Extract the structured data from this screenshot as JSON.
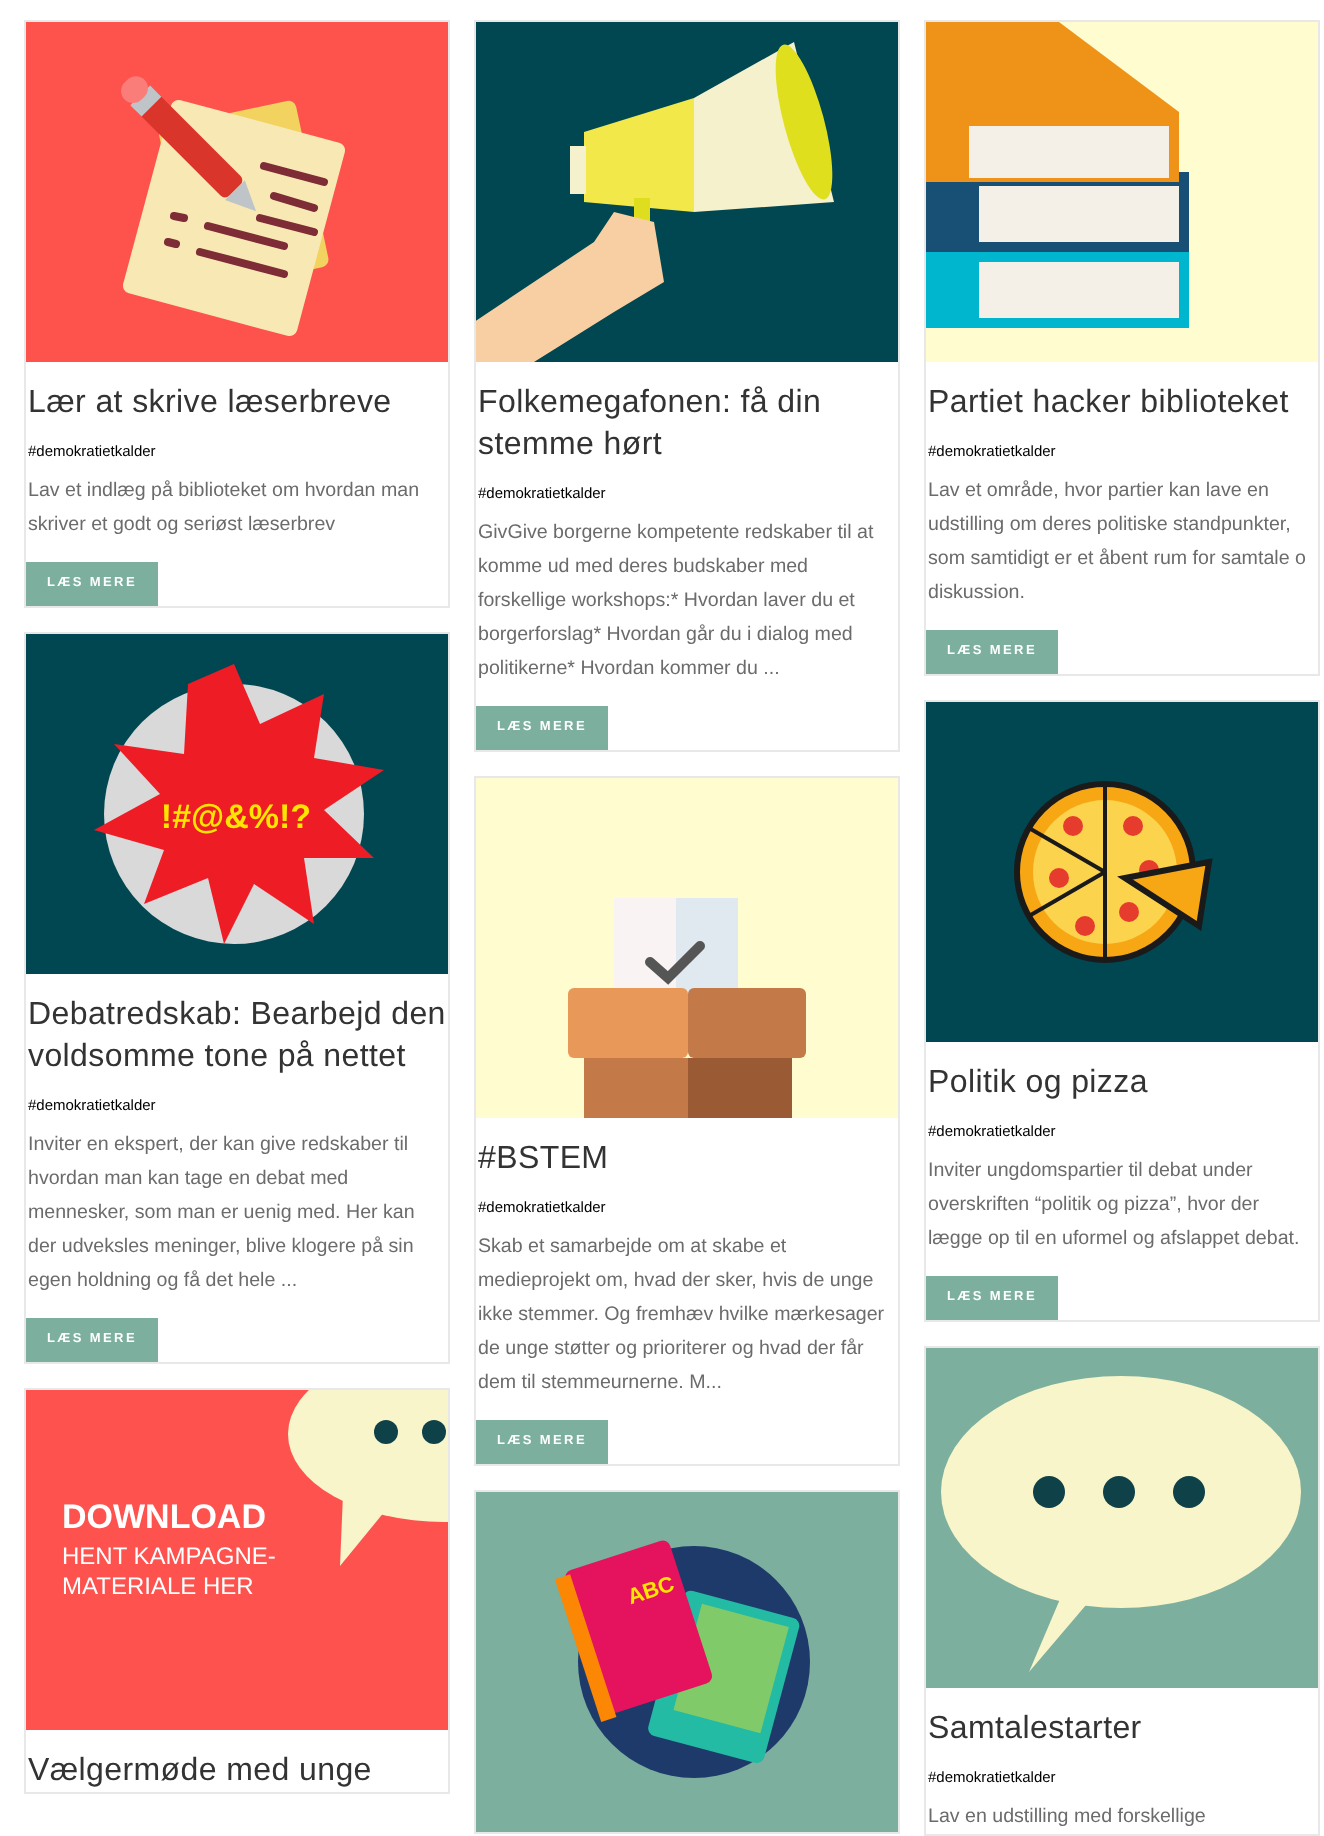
{
  "columns": [
    {
      "cards": [
        {
          "image": {
            "kind": "notes"
          },
          "title": "Lær at skrive læserbreve",
          "tag": "#demokratietkalder",
          "text": "Lav et indlæg på biblioteket om hvordan man skriver et godt og seriøst læserbrev",
          "button": "LÆS MERE"
        },
        {
          "image": {
            "kind": "outburst",
            "text": "!#@&%!?"
          },
          "title": "Debatredskab: Bearbejd den voldsomme tone på nettet",
          "tag": "#demokratietkalder",
          "text": "Inviter en ekspert, der kan give redskaber til hvordan man kan tage en debat med mennesker, som man er uenig med. Her kan der udveksles meninger, blive klogere på sin egen holdning og få det hele ...",
          "button": "LÆS MERE"
        },
        {
          "image": {
            "kind": "download",
            "heading": "DOWNLOAD",
            "text": "HENT KAMPAGNE-MATERIALE HER"
          },
          "title": "Vælgermøde med unge"
        }
      ]
    },
    {
      "cards": [
        {
          "image": {
            "kind": "megaphone"
          },
          "title": "Folkemegafonen: få din stemme hørt",
          "tag": "#demokratietkalder",
          "text": "GivGive borgerne kompetente redskaber til at komme ud med deres budskaber med forskellige workshops:* Hvordan laver du et borgerforslag* Hvordan går du i dialog med politikerne* Hvordan kommer du ...",
          "button": "LÆS MERE"
        },
        {
          "image": {
            "kind": "ballot"
          },
          "title": "#BSTEM",
          "tag": "#demokratietkalder",
          "text": "Skab et samarbejde om at skabe et medieprojekt om, hvad der sker, hvis de unge ikke stemmer. Og fremhæv hvilke mærkesager de unge støtter og prioriterer og hvad der får dem til stemmeurnerne. M...",
          "button": "LÆS MERE"
        },
        {
          "image": {
            "kind": "abc-books",
            "text": "ABC"
          }
        }
      ]
    },
    {
      "cards": [
        {
          "image": {
            "kind": "books"
          },
          "title": "Partiet hacker biblioteket",
          "tag": "#demokratietkalder",
          "text": "Lav et område, hvor partier kan lave en udstilling om deres politiske standpunkter, som samtidigt er et åbent rum for samtale o diskussion.",
          "button": "LÆS MERE"
        },
        {
          "image": {
            "kind": "pizza"
          },
          "title": "Politik og pizza",
          "tag": "#demokratietkalder",
          "text": "Inviter ungdomspartier til debat under overskriften “politik og pizza”, hvor der lægge op til en uformel og afslappet debat.",
          "button": "LÆS MERE"
        },
        {
          "image": {
            "kind": "speech"
          },
          "title": "Samtalestarter",
          "tag": "#demokratietkalder",
          "text": "Lav en udstilling med forskellige"
        }
      ]
    }
  ]
}
